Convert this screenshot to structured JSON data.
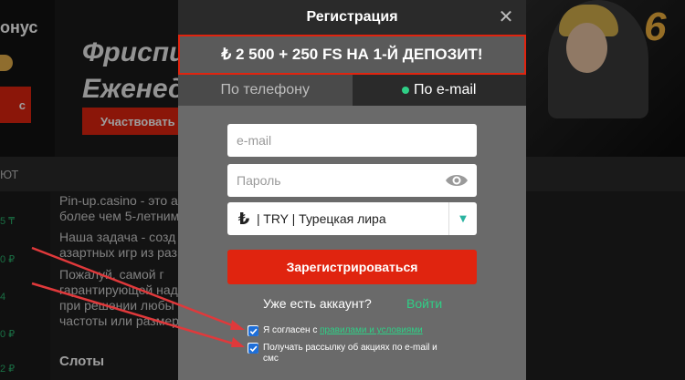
{
  "background": {
    "hero_left_fragment": "онус",
    "hero_left_button_fragment": "с",
    "hero_title_line1": "Фриспи",
    "hero_title_line2": "Еженед",
    "join_button": "Участвовать",
    "nav_fragment": "ЮТ",
    "side_values": [
      "5 ₸",
      "0 ₽",
      "4",
      "0 ₽",
      "2 ₽"
    ],
    "paragraphs": [
      "Pin-up.casino - это ак                                              ощая из команды высокооп",
      "более чем 5-летним",
      "Наша задача - созд                                                  самых требовательных цен",
      "азартных игр из раз",
      "Пожалуй, самой г                                           безупречной Репутация",
      "гарантирующей над                                             клиентов, проявляющей м",
      "при решении любы                                          выплаты любого выигрыш",
      "частоты или размер"
    ],
    "slots_heading": "Слоты",
    "hero_number": "6"
  },
  "modal": {
    "title": "Регистрация",
    "close_glyph": "✕",
    "promo": "₺ 2 500 + 250 FS НА 1-Й ДЕПОЗИТ!",
    "tabs": {
      "phone": "По телефону",
      "email": "По e-mail",
      "active": "email"
    },
    "email_placeholder": "e-mail",
    "password_placeholder": "Пароль",
    "currency_symbol": "₺",
    "currency_text": "| TRY | Турецкая лира",
    "register_button": "Зарегистрироваться",
    "have_account": "Уже есть аккаунт?",
    "login_link": "Войти",
    "agree_prefix": "Я согласен с ",
    "agree_link": "правилами и условиями",
    "newsletter_line1": "Получать рассылку об акциях по e-mail и",
    "newsletter_line2": "смс",
    "checkbox_agree_checked": true,
    "checkbox_newsletter_checked": true
  },
  "colors": {
    "accent_red": "#e0240f",
    "accent_green": "#2fcf86",
    "modal_bg": "#6a6a6a"
  }
}
